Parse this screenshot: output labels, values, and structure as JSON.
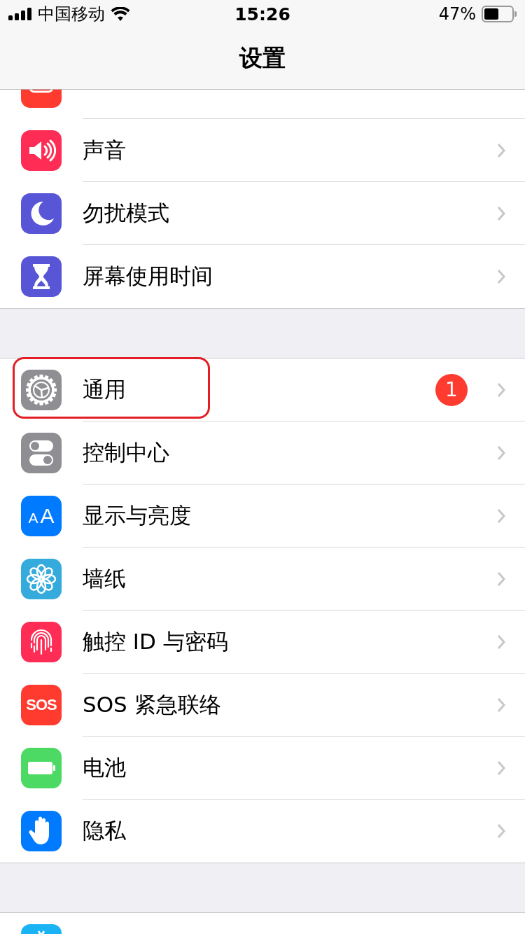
{
  "status_bar": {
    "carrier": "中国移动",
    "time": "15:26",
    "battery": "47%"
  },
  "nav": {
    "title": "设置"
  },
  "groups": [
    {
      "rows": [
        {
          "kind": "bell",
          "color": "#ff3b30",
          "outlined": false
        },
        {
          "kind": "speaker",
          "color": "#ff2d55",
          "label": "声音",
          "outlined": false
        },
        {
          "kind": "moon",
          "color": "#5856d6",
          "label": "勿扰模式",
          "outlined": false
        },
        {
          "kind": "hourglass",
          "color": "#5856d6",
          "label": "屏幕使用时间",
          "outlined": false
        }
      ]
    },
    {
      "rows": [
        {
          "kind": "gear",
          "color": "#8e8e93",
          "label": "通用",
          "badge": "1",
          "outlined": true
        },
        {
          "kind": "toggles",
          "color": "#8e8e93",
          "label": "控制中心",
          "outlined": false
        },
        {
          "kind": "text",
          "icon_text": "AA",
          "color": "#007aff",
          "label": "显示与亮度",
          "outlined": false
        },
        {
          "kind": "flower",
          "color": "#35aadc",
          "label": "墙纸",
          "outlined": false
        },
        {
          "kind": "fingerprint",
          "color": "#ff2d55",
          "label": "触控 ID 与密码",
          "outlined": false
        },
        {
          "kind": "text",
          "icon_text": "SOS",
          "color": "#ff3b30",
          "label": "SOS 紧急联络",
          "outlined": false
        },
        {
          "kind": "battery",
          "color": "#4cd964",
          "label": "电池",
          "outlined": false
        },
        {
          "kind": "hand",
          "color": "#007aff",
          "label": "隐私",
          "outlined": false
        }
      ]
    },
    {
      "rows": [
        {
          "kind": "store",
          "color": "#1ab4f5",
          "outlined": false
        }
      ]
    }
  ]
}
